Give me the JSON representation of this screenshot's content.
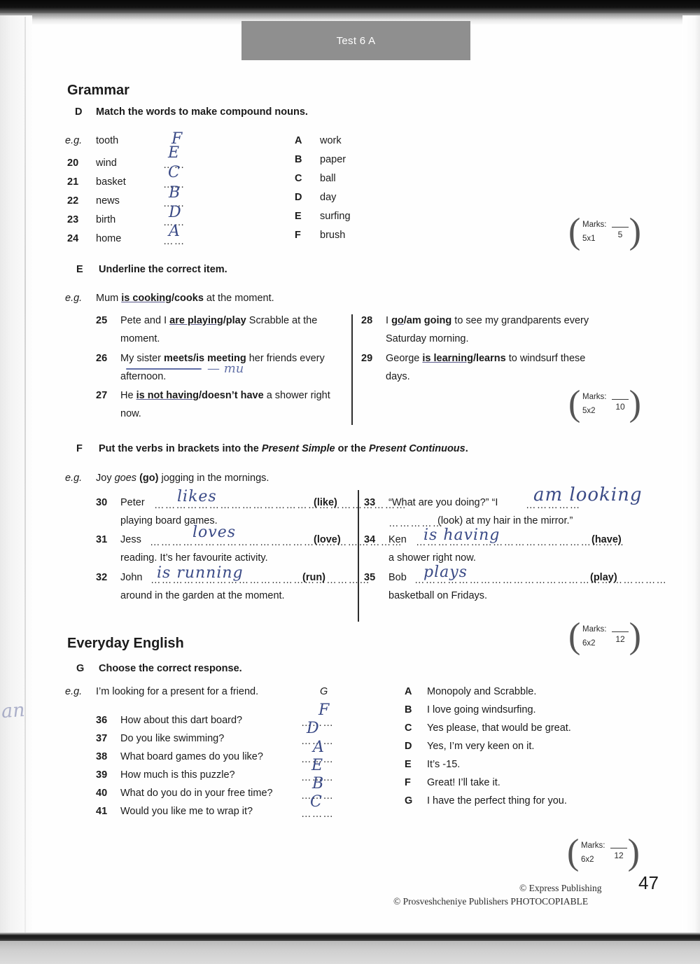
{
  "header": {
    "test_label": "Test 6 A"
  },
  "sections": {
    "grammar": {
      "title": "Grammar"
    },
    "everyday": {
      "title": "Everyday English"
    }
  },
  "exercise_d": {
    "letter": "D",
    "instruction": "Match the words to make compound nouns.",
    "eg_label": "e.g.",
    "eg_word": "tooth",
    "eg_answer": "F",
    "items": [
      {
        "num": "20",
        "word": "wind",
        "answer": "E"
      },
      {
        "num": "21",
        "word": "basket",
        "answer": "C"
      },
      {
        "num": "22",
        "word": "news",
        "answer": "B"
      },
      {
        "num": "23",
        "word": "birth",
        "answer": "D"
      },
      {
        "num": "24",
        "word": "home",
        "answer": "A"
      }
    ],
    "options": [
      {
        "letter": "A",
        "text": "work"
      },
      {
        "letter": "B",
        "text": "paper"
      },
      {
        "letter": "C",
        "text": "ball"
      },
      {
        "letter": "D",
        "text": "day"
      },
      {
        "letter": "E",
        "text": "surfing"
      },
      {
        "letter": "F",
        "text": "brush"
      }
    ],
    "marks": {
      "label": "Marks:",
      "mult": "5x1",
      "total": "5"
    }
  },
  "exercise_e": {
    "letter": "E",
    "instruction": "Underline the correct item.",
    "eg_label": "e.g.",
    "eg_line": "Mum is cooking/cooks at the moment.",
    "items": [
      {
        "num": "25",
        "line1": "Pete and I are playing/play Scrabble at the",
        "line2": "moment."
      },
      {
        "num": "26",
        "line1": "My sister meets/is meeting her friends every",
        "line2": "afternoon."
      },
      {
        "num": "27",
        "line1": "He is not having/doesn’t have a shower right",
        "line2": "now."
      },
      {
        "num": "28",
        "line1": "I go/am going to see my grandparents every",
        "line2": "Saturday morning."
      },
      {
        "num": "29",
        "line1": "George is learning/learns to windsurf these",
        "line2": "days."
      }
    ],
    "marks": {
      "label": "Marks:",
      "mult": "5x2",
      "total": "10"
    }
  },
  "exercise_f": {
    "letter": "F",
    "instruction_pre": "Put the verbs in brackets into the ",
    "instruction_it1": "Present Simple",
    "instruction_mid": " or the ",
    "instruction_it2": "Present Continuous",
    "instruction_end": ".",
    "eg_label": "e.g.",
    "eg_pre": "Joy ",
    "eg_verb": "goes",
    "eg_post": " (go) jogging in the mornings.",
    "items": [
      {
        "num": "30",
        "subject": "Peter",
        "answer": "likes",
        "verb": "(like)",
        "tail": "playing board games."
      },
      {
        "num": "31",
        "subject": "Jess",
        "answer": "loves",
        "verb": "(love)",
        "tail": "reading. It’s her favourite activity."
      },
      {
        "num": "32",
        "subject": "John",
        "answer": "is running",
        "verb": "(run)",
        "tail": "around in the garden at the moment."
      },
      {
        "num": "33",
        "subject": "“What are you doing?” “I",
        "answer": "am looking",
        "verb": "(look)",
        "tail": "(look) at my hair in the mirror.”"
      },
      {
        "num": "34",
        "subject": "Ken",
        "answer": "is having",
        "verb": "(have)",
        "tail": "a shower right now."
      },
      {
        "num": "35",
        "subject": "Bob",
        "answer": "plays",
        "verb": "(play)",
        "tail": "basketball on Fridays."
      }
    ],
    "marks": {
      "label": "Marks:",
      "mult": "6x2",
      "total": "12"
    }
  },
  "exercise_g": {
    "letter": "G",
    "instruction": "Choose the correct response.",
    "eg_label": "e.g.",
    "eg_line": "I’m looking for a present for a friend.",
    "eg_answer": "G",
    "items": [
      {
        "num": "36",
        "question": "How about this dart board?",
        "answer": "F"
      },
      {
        "num": "37",
        "question": "Do you like swimming?",
        "answer": "D"
      },
      {
        "num": "38",
        "question": "What board games do you like?",
        "answer": "A"
      },
      {
        "num": "39",
        "question": "How much is this puzzle?",
        "answer": "E"
      },
      {
        "num": "40",
        "question": "What do you do in your free time?",
        "answer": "B"
      },
      {
        "num": "41",
        "question": "Would you like me to wrap it?",
        "answer": "C"
      }
    ],
    "options": [
      {
        "letter": "A",
        "text": "Monopoly and Scrabble."
      },
      {
        "letter": "B",
        "text": "I love going windsurfing."
      },
      {
        "letter": "C",
        "text": "Yes please, that would be great."
      },
      {
        "letter": "D",
        "text": "Yes, I’m very keen on it."
      },
      {
        "letter": "E",
        "text": "It’s -15."
      },
      {
        "letter": "F",
        "text": "Great! I’ll take it."
      },
      {
        "letter": "G",
        "text": "I have the perfect thing for you."
      }
    ],
    "marks": {
      "label": "Marks:",
      "mult": "6x2",
      "total": "12"
    }
  },
  "footer": {
    "line1": "© Express Publishing",
    "line2": "© Prosveshcheniye Publishers PHOTOCOPIABLE",
    "page_number": "47"
  },
  "margin_mark": "an",
  "dots": {
    "short": "……",
    "g_answer": "………",
    "long": "……………………………………………………………",
    "medium": "……………………………………………………",
    "mid2": "…………………………………………………",
    "look": "……………"
  },
  "colors": {
    "band": "#8f8f8f",
    "ink": "#3a4a86",
    "text": "#1b1b1b"
  }
}
